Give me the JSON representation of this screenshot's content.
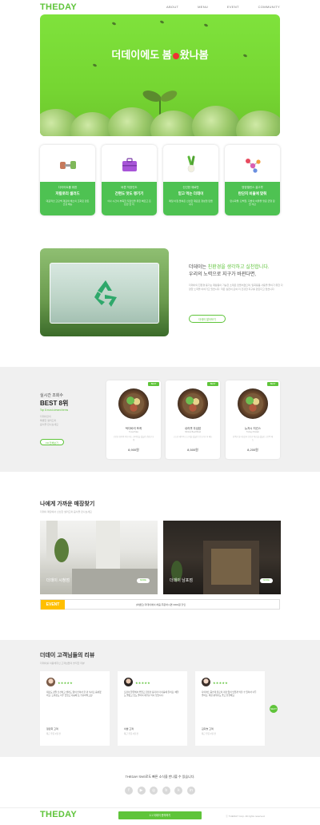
{
  "header": {
    "logo": "THEDAY",
    "nav": [
      "ABOUT",
      "MENU",
      "EVENT",
      "COMMUNITY"
    ]
  },
  "hero": {
    "title_prefix": "더데이에도 봄",
    "title_suffix": "왔나봄",
    "bg_color": "#7ddd3a"
  },
  "products": [
    {
      "icon": "dumbbell-icon",
      "sub": "다이어트를 위한",
      "title": "저칼로리 샐러드",
      "desc": "대표적인 고단백 재료와 채소의 조화로 만든 건강 메뉴"
    },
    {
      "icon": "suitcase-icon",
      "sub": "바쁜 직장인도",
      "title": "간편도 맛도 챙기기",
      "desc": "식사 시간이 부족한 직장인을 위한 빠르고 든든한 한 끼"
    },
    {
      "icon": "green-onion-icon",
      "sub": "신선한 재료만",
      "title": "믿고 먹는 더데이",
      "desc": "매일 아침 들여온 신선한 재료로 정성껏 만듭니다"
    },
    {
      "icon": "molecule-icon",
      "sub": "영양밸런스 골고루",
      "title": "탄단지 비율에 맞춰",
      "desc": "탄수화물, 단백질, 지방의 비율을 맞춘 균형 잡힌 식단"
    }
  ],
  "eco": {
    "line1_prefix": "더데이는 ",
    "line1_highlight": "친환경을 생각하고 실천합니다.",
    "line2": "우리의 노력으로 지구가 바뀐다면,",
    "paragraph": "더데이의 친환경 용기는 재활용이 가능한 소재로 만들어졌으며, 일회용품 사용을 줄이기 위한 다양한 노력을 이어가고 있습니다. 작은 실천이 모여 더 건강한 지구를 만든다고 믿습니다.",
    "button": "더데이 알아보기"
  },
  "best": {
    "sub": "실시간 조회수",
    "title": "BEST 8위",
    "tag": "Top 8 most-viewed items",
    "desc": [
      "더데이만의",
      "특별한 샐러드와",
      "음식을 만나보세요"
    ],
    "button": "Fill 전체보기",
    "items": [
      {
        "badge": "BEST",
        "name": "탁다바리 포케",
        "en": "Tuna Poke",
        "desc": "신선한 참치와 아보카도, 현미밥을 곁들인 건강한 포케",
        "price": "8,900원"
      },
      {
        "badge": "BEST",
        "name": "쉬리캣 우섭밥",
        "en": "Shrimp Beef Bowl",
        "desc": "고소한 새우와 소고기를 곁들인 든든한 한 끼 메뉴",
        "price": "8,500원"
      },
      {
        "badge": "BEST",
        "name": "뉴저시 치킨스",
        "en": "Turkey Protein",
        "desc": "담백한 닭가슴살과 신선한 채소를 곁들인 고단백 메뉴",
        "price": "8,200원"
      }
    ]
  },
  "stores": {
    "title": "나에게 가까운 매장찾기",
    "sub": "더데이 매장에서 신선한 샐러드와 음식을 만나보세요",
    "items": [
      {
        "label": "더데이 시청점",
        "button": "MORE"
      },
      {
        "label": "더데이 남포점",
        "button": "MORE"
      }
    ],
    "event": {
      "badge": "EVENT",
      "text": "[이벤트] 더데이에서 처음 주문하시면 3000원 할인"
    }
  },
  "reviews": {
    "title": "더데이 고객님들의 리뷰",
    "sub": "더데이를 이용해주신 고객님들의 솔직한 리뷰",
    "stars": "★★★★★",
    "items": [
      {
        "text": "재료도 정말 신선하고 샐러드 양이 많아서 한 끼 식사로 충분했어요. 드레싱도 너무 맛있고 다음에 또 주문하려고요!",
        "name": "정민희 고객",
        "date": "최근 주문 1일 전"
      },
      {
        "text": "포장이 깔끔해서 좋았고 친환경 용기라 더 마음에 들어요. 배달도 빨랐고 맛도 좋아서 재주문 의사 있습니다.",
        "name": "이쌍 고객",
        "date": "최근 주문 1일 전"
      },
      {
        "text": "다이어트 중인데 칼로리 걱정 없이 맛있게 먹을 수 있어서 너무 좋아요. 매장 분위기도 좋고 친절해요.",
        "name": "김다솔 고객",
        "date": "최근 주문 1일 전"
      }
    ],
    "next": "NEXT"
  },
  "sns": {
    "title": "THEDAY SNS로도 빠른 소식을 만나볼 수 있습니다.",
    "icons": [
      "facebook-icon",
      "youtube-icon",
      "instagram-icon",
      "blog-icon",
      "kakao-icon",
      "linkedin-icon"
    ],
    "glyphs": [
      "f",
      "▶",
      "◎",
      "b",
      "k",
      "in"
    ]
  },
  "footer": {
    "logo": "THEDAY",
    "button": "1:1 더데이 문의하기",
    "copyright": "ⓒ THEDAY Corp. All rights reserved."
  },
  "colors": {
    "brand": "#5fc43a",
    "event": "#ffbf00"
  }
}
